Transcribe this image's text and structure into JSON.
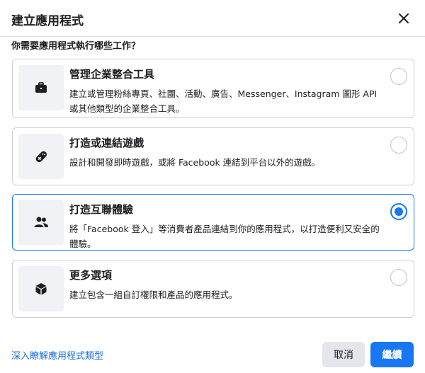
{
  "dialog": {
    "title": "建立應用程式",
    "question": "你需要應用程式執行哪些工作？"
  },
  "options": [
    {
      "title": "管理企業整合工具",
      "description": "建立或管理粉絲專頁、社團、活動、廣告、Messenger、Instagram 圖形 API 或其他類型的企業整合工具。",
      "icon": "briefcase-icon",
      "selected": false
    },
    {
      "title": "打造或連結遊戲",
      "description": "設計和開發即時遊戲，或將 Facebook 連結到平台以外的遊戲。",
      "icon": "gamepad-icon",
      "selected": false
    },
    {
      "title": "打造互聯體驗",
      "description": "將「Facebook 登入」等消費者產品連結到你的應用程式，以打造便利又安全的體驗。",
      "icon": "people-icon",
      "selected": true
    },
    {
      "title": "更多選項",
      "description": "建立包含一組自訂權限和產品的應用程式。",
      "icon": "cube-icon",
      "selected": false
    }
  ],
  "footer": {
    "learn_more": "深入瞭解應用程式類型",
    "cancel_label": "取消",
    "continue_label": "繼續"
  },
  "colors": {
    "accent": "#1877f2",
    "link": "#216fdb",
    "border": "#ccd0d5",
    "icon_bg": "#f0f2f5"
  }
}
